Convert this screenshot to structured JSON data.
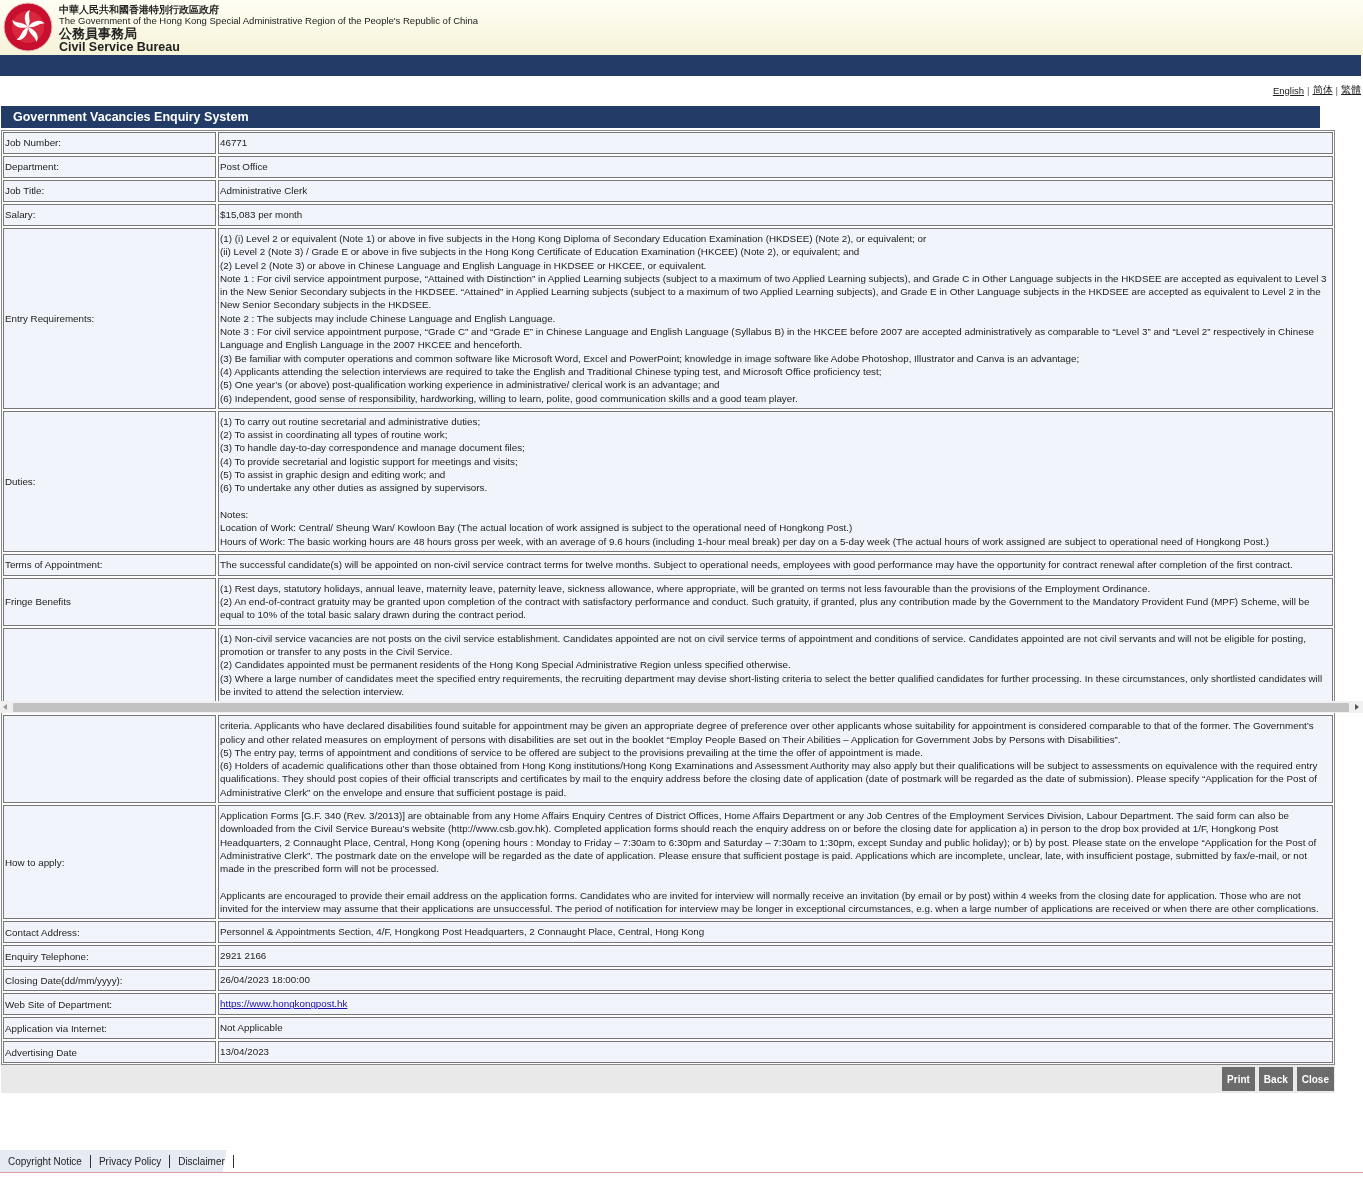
{
  "header": {
    "cn_title": "中華人民共和國香港特別行政區政府",
    "en_title": "The Government of the Hong Kong Special Administrative Region of the People's Republic of China",
    "bureau_cn": "公務員事務局",
    "bureau_en": "Civil Service Bureau"
  },
  "languages": {
    "separator": "|",
    "items": [
      "English",
      "简体",
      "繁體"
    ]
  },
  "panel_title": "Government Vacancies Enquiry System",
  "rows": [
    {
      "kind": "text",
      "label": "Job Number:",
      "blocks": [
        [
          "46771"
        ]
      ]
    },
    {
      "kind": "text",
      "label": "Department:",
      "blocks": [
        [
          "Post Office"
        ]
      ]
    },
    {
      "kind": "text",
      "label": "Job Title:",
      "blocks": [
        [
          "Administrative Clerk"
        ]
      ]
    },
    {
      "kind": "text",
      "label": "Salary:",
      "blocks": [
        [
          "$15,083 per month"
        ]
      ]
    },
    {
      "kind": "text",
      "label": "Entry Requirements:",
      "blocks": [
        [
          "(1) (i) Level 2 or equivalent (Note 1) or above in five subjects in the Hong Kong Diploma of Secondary Education Examination (HKDSEE) (Note 2), or equivalent; or",
          "(ii) Level 2 (Note 3) / Grade E or above in five subjects in the Hong Kong Certificate of Education Examination (HKCEE) (Note 2), or equivalent; and",
          "(2) Level 2 (Note 3) or above in Chinese Language and English Language in HKDSEE or HKCEE, or equivalent.",
          "Note 1 : For civil service appointment purpose, “Attained with Distinction” in Applied Learning subjects (subject to a maximum of two Applied Learning subjects), and Grade C in Other Language subjects in the HKDSEE are accepted as equivalent to Level 3 in the New Senior Secondary subjects in the HKDSEE. “Attained” in Applied Learning subjects (subject to a maximum of two Applied Learning subjects), and Grade E in Other Language subjects in the HKDSEE are accepted as equivalent to Level 2 in the New Senior Secondary subjects in the HKDSEE.",
          "Note 2 : The subjects may include Chinese Language and English Language.",
          "Note 3 : For civil service appointment purpose, “Grade C” and “Grade E” in Chinese Language and English Language (Syllabus B) in the HKCEE before 2007 are accepted administratively as comparable to “Level 3” and “Level 2” respectively in Chinese Language and English Language in the 2007 HKCEE and henceforth.",
          "(3) Be familiar with computer operations and common software like Microsoft Word, Excel and PowerPoint; knowledge in image software like Adobe Photoshop, Illustrator and Canva is an advantage;",
          "(4) Applicants attending the selection interviews are required to take the English and Traditional Chinese typing test, and Microsoft Office proficiency test;",
          "(5) One year’s (or above) post-qualification working experience in administrative/ clerical work is an advantage; and",
          "(6) Independent, good sense of responsibility, hardworking, willing to learn, polite, good communication skills and a good team player."
        ]
      ]
    },
    {
      "kind": "text",
      "label": "Duties:",
      "blocks": [
        [
          "(1) To carry out routine secretarial and administrative duties;",
          "(2) To assist in coordinating all types of routine work;",
          "(3) To handle day-to-day correspondence and manage document files;",
          "(4) To provide secretarial and logistic support for meetings and visits;",
          "(5) To assist in graphic design and editing work; and",
          "(6) To undertake any other duties as assigned by supervisors."
        ],
        [
          "Notes:",
          "Location of Work: Central/ Sheung Wan/ Kowloon Bay (The actual location of work assigned is subject to the operational need of Hongkong Post.)",
          "Hours of Work: The basic working hours are 48 hours gross per week, with an average of 9.6 hours (including 1-hour meal break) per day on a 5-day week (The actual hours of work assigned are subject to operational need of Hongkong Post.)"
        ]
      ]
    },
    {
      "kind": "text",
      "label": "Terms of Appointment:",
      "blocks": [
        [
          "The successful candidate(s) will be appointed on non-civil service contract terms for twelve months. Subject to operational needs, employees with good performance may have the opportunity for contract renewal after completion of the first contract."
        ]
      ]
    },
    {
      "kind": "text",
      "label": "Fringe Benefits",
      "blocks": [
        [
          "(1) Rest days, statutory holidays, annual leave, maternity leave, paternity leave, sickness allowance, where appropriate, will be granted on terms not less favourable than the provisions of the Employment Ordinance.",
          "(2) An end-of-contract gratuity may be granted upon completion of the contract with satisfactory performance and conduct. Such gratuity, if granted, plus any contribution made by the Government to the Mandatory Provident Fund (MPF) Scheme, will be equal to 10% of the total basic salary drawn during the contract period."
        ]
      ]
    },
    {
      "kind": "split",
      "blocks": [
        [
          "(1) Non-civil service vacancies are not posts on the civil service establishment. Candidates appointed are not on civil service terms of appointment and conditions of service. Candidates appointed are not civil servants and will not be eligible for posting, promotion or transfer to any posts in the Civil Service.",
          "(2) Candidates appointed must be permanent residents of the Hong Kong Special Administrative Region unless specified otherwise.",
          "(3) Where a large number of candidates meet the specified entry requirements, the recruiting department may devise short-listing criteria to select the better qualified candidates for further processing. In these circumstances, only shortlisted candidates will be invited to attend the selection interview."
        ]
      ],
      "continued_blocks": [
        [
          "criteria. Applicants who have declared disabilities found suitable for appointment may be given an appropriate degree of preference over other applicants whose suitability for appointment is considered comparable to that of the former. The Government’s policy and other related measures on employment of persons with disabilities are set out in the booklet “Employ People Based on Their Abilities – Application for Government Jobs by Persons with Disabilities”.",
          "(5) The entry pay, terms of appointment and conditions of service to be offered are subject to the provisions prevailing at the time the offer of appointment is made.",
          "(6) Holders of academic qualifications other than those obtained from Hong Kong institutions/Hong Kong Examinations and Assessment Authority may also apply but their qualifications will be subject to assessments on equivalence with the required entry qualifications. They should post copies of their official transcripts and certificates by mail to the enquiry address before the closing date of application (date of postmark will be regarded as the date of submission). Please specify “Application for the Post of Administrative Clerk” on the envelope and ensure that sufficient postage is paid."
        ]
      ]
    },
    {
      "kind": "text",
      "label": "How to apply:",
      "blocks": [
        [
          "Application Forms [G.F. 340 (Rev. 3/2013)] are obtainable from any Home Affairs Enquiry Centres of District Offices, Home Affairs Department or any Job Centres of the Employment Services Division, Labour Department. The said form can also be downloaded from the Civil Service Bureau’s website (http://www.csb.gov.hk). Completed application forms should reach the enquiry address on or before the closing date for application a) in person to the drop box provided at 1/F, Hongkong Post Headquarters, 2 Connaught Place, Central, Hong Kong (opening hours : Monday to Friday – 7:30am to 6:30pm and Saturday – 7:30am to 1:30pm, except Sunday and public holiday); or b) by post. Please state on the envelope “Application for the Post of Administrative Clerk”. The postmark date on the envelope will be regarded as the date of application. Please ensure that sufficient postage is paid. Applications which are incomplete, unclear, late, with insufficient postage, submitted by fax/e-mail, or not made in the prescribed form will not be processed."
        ],
        [
          "Applicants are encouraged to provide their email address on the application forms. Candidates who are invited for interview will normally receive an invitation (by email or by post) within 4 weeks from the closing date for application. Those who are not invited for the interview may assume that their applications are unsuccessful. The period of notification for interview may be longer in exceptional circumstances, e.g. when a large number of applications are received or when there are other complications."
        ]
      ]
    },
    {
      "kind": "text",
      "label": "Contact Address:",
      "blocks": [
        [
          "Personnel & Appointments Section, 4/F, Hongkong Post Headquarters, 2 Connaught Place, Central, Hong Kong"
        ]
      ]
    },
    {
      "kind": "text",
      "label": "Enquiry Telephone:",
      "blocks": [
        [
          "2921 2166"
        ]
      ]
    },
    {
      "kind": "text",
      "label": "Closing Date(dd/mm/yyyy):",
      "blocks": [
        [
          "26/04/2023 18:00:00"
        ]
      ]
    },
    {
      "kind": "link",
      "label": "Web Site of Department:",
      "blocks": [
        [
          "https://www.hongkongpost.hk"
        ]
      ]
    },
    {
      "kind": "text",
      "label": "Application via Internet:",
      "blocks": [
        [
          "Not Applicable"
        ]
      ]
    },
    {
      "kind": "text",
      "label": "Advertising Date",
      "blocks": [
        [
          "13/04/2023"
        ]
      ]
    }
  ],
  "buttons": [
    "Print",
    "Back",
    "Close"
  ],
  "footer_links": [
    "Copyright Notice",
    "Privacy Policy",
    "Disclaimer"
  ]
}
